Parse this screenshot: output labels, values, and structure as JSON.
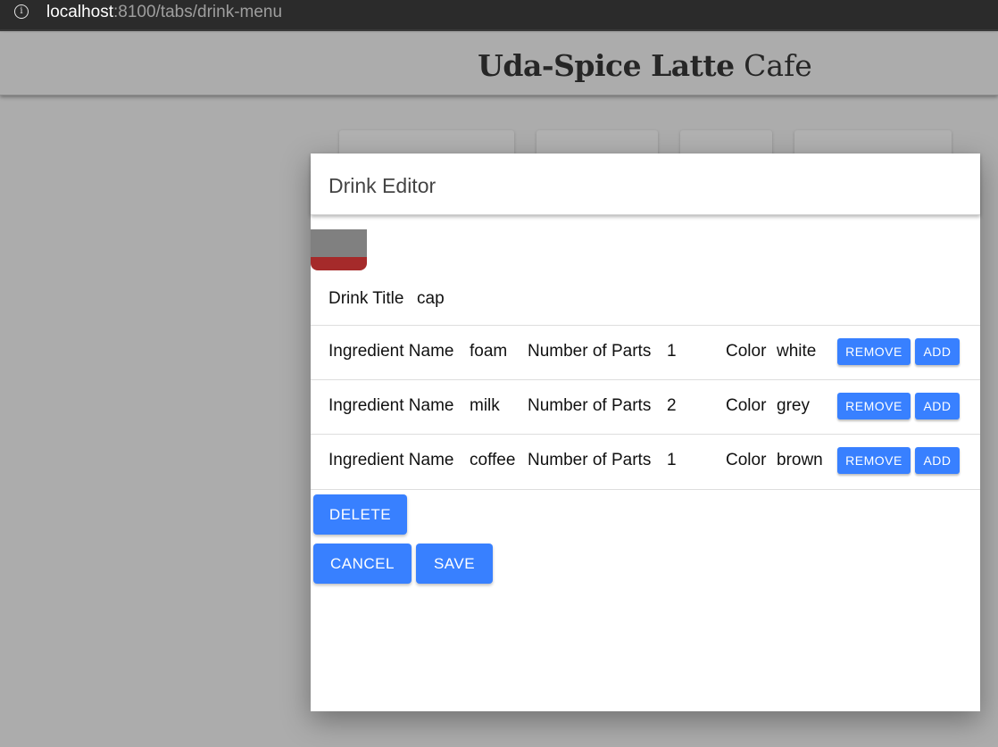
{
  "browser": {
    "url_host": "localhost",
    "url_rest": ":8100/tabs/drink-menu"
  },
  "app": {
    "title_bold": "Uda-Spice Latte",
    "title_light": "Cafe"
  },
  "modal": {
    "title": "Drink Editor",
    "drink_graphic": {
      "layers": [
        "grey",
        "brown"
      ]
    },
    "title_label": "Drink Title",
    "title_value": "cap",
    "ingredient_labels": {
      "name": "Ingredient Name",
      "parts": "Number of Parts",
      "color": "Color"
    },
    "ingredients": [
      {
        "name": "foam",
        "parts": "1",
        "color": "white"
      },
      {
        "name": "milk",
        "parts": "2",
        "color": "grey"
      },
      {
        "name": "coffee",
        "parts": "1",
        "color": "brown"
      }
    ],
    "remove_label": "REMOVE",
    "add_label": "ADD",
    "delete_label": "DELETE",
    "cancel_label": "CANCEL",
    "save_label": "SAVE"
  },
  "colors": {
    "primary_button": "#3880ff",
    "backdrop": "#acacac",
    "graphic_top": "#808080",
    "graphic_bottom": "#a52a2a"
  }
}
